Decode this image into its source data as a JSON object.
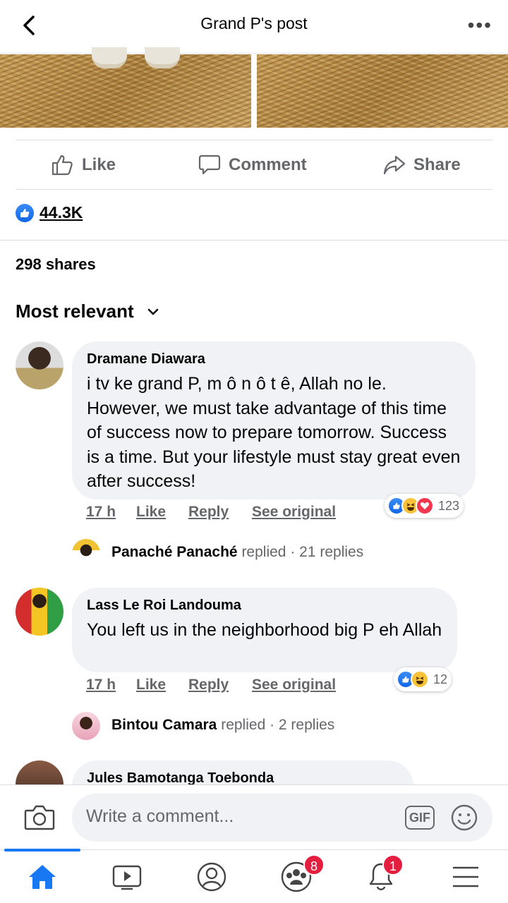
{
  "header": {
    "title": "Grand P's post"
  },
  "actions": {
    "like": "Like",
    "comment": "Comment",
    "share": "Share"
  },
  "reactions": {
    "count": "44.3K"
  },
  "shares": "298 shares",
  "sort": "Most relevant",
  "comments": [
    {
      "author": "Dramane Diawara",
      "text": "i tv ke grand P, m ô n ô t ê, Allah no le. However, we must take advantage of this time of success now to prepare tomorrow. Success is a time. But your lifestyle must stay great even after success!",
      "time": "17 h",
      "like": "Like",
      "reply": "Reply",
      "see_original": "See original",
      "reaction_count": "123",
      "reply_author": "Panaché Panaché",
      "reply_verb": "replied",
      "reply_count": "· 21 replies"
    },
    {
      "author": "Lass Le Roi Landouma",
      "text": "You left us in the neighborhood big P eh Allah",
      "time": "17 h",
      "like": "Like",
      "reply": "Reply",
      "see_original": "See original",
      "reaction_count": "12",
      "reply_author": "Bintou Camara",
      "reply_verb": "replied",
      "reply_count": "· 2 replies"
    },
    {
      "author": "Jules Bamotanga Toebonda"
    }
  ],
  "composer": {
    "placeholder": "Write a comment...",
    "gif_label": "GIF"
  },
  "tabs": {
    "groups_badge": "8",
    "notifications_badge": "1"
  },
  "colors": {
    "accent": "#1877f2",
    "badge": "#e41e3f",
    "bubble": "#f0f2f5"
  },
  "icons": [
    "back-icon",
    "more-icon",
    "like-icon",
    "comment-icon",
    "share-icon",
    "chevron-down-icon",
    "camera-icon",
    "gif-icon",
    "emoji-icon",
    "home-icon",
    "watch-icon",
    "profile-icon",
    "groups-icon",
    "bell-icon",
    "menu-icon"
  ]
}
